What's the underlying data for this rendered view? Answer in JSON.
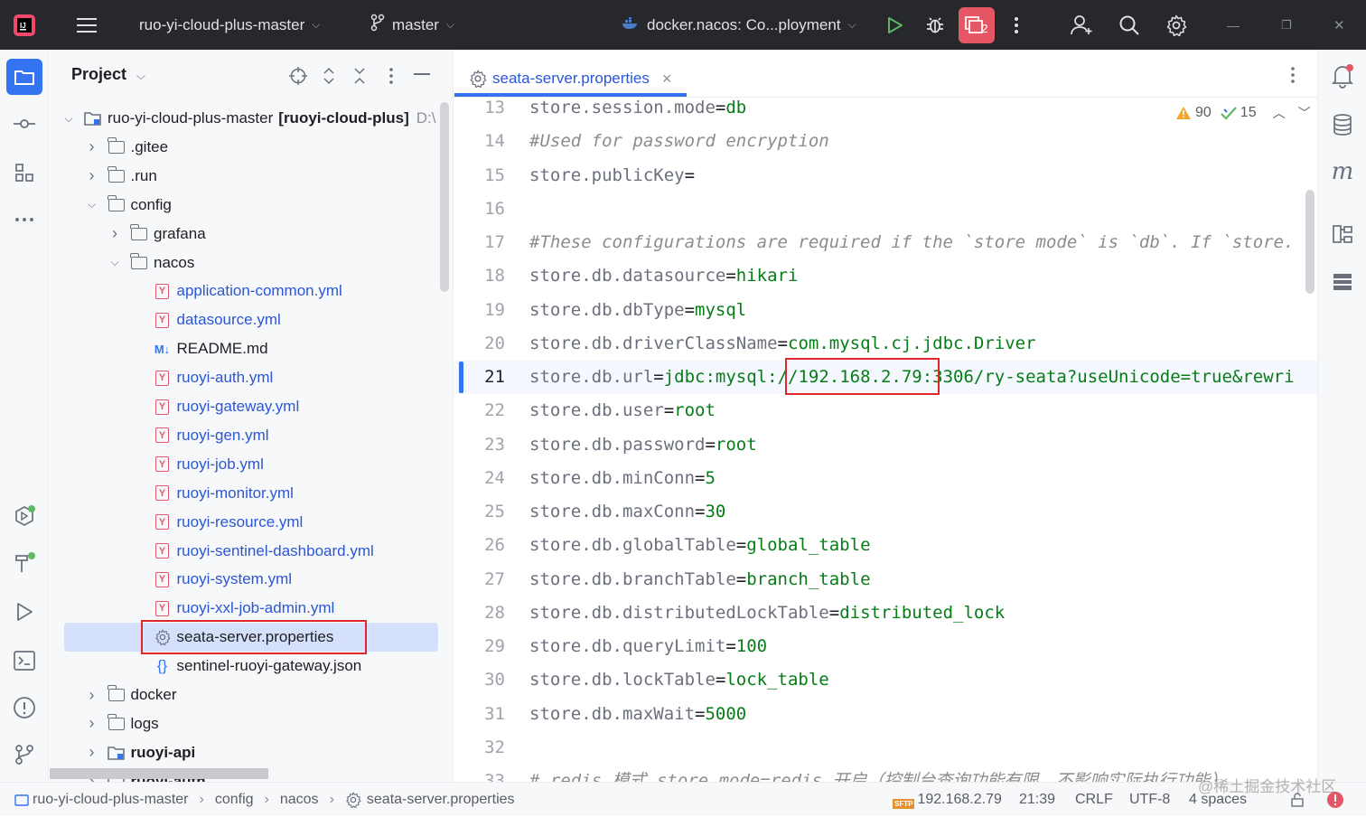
{
  "titlebar": {
    "project_name": "ruo-yi-cloud-plus-master",
    "branch": "master",
    "run_config": "docker.nacos: Co...ployment",
    "vcs_badge": "2",
    "minimize": "—",
    "restore": "❐",
    "close": "✕"
  },
  "project_panel": {
    "title": "Project",
    "tree": [
      {
        "label": "ruo-yi-cloud-plus-master",
        "suffix": "[ruoyi-cloud-plus]",
        "path": "D:\\",
        "type": "module",
        "expanded": true
      },
      {
        "label": ".gitee",
        "type": "folder",
        "expanded": false
      },
      {
        "label": ".run",
        "type": "folder",
        "expanded": false
      },
      {
        "label": "config",
        "type": "folder",
        "expanded": true
      },
      {
        "label": "grafana",
        "type": "folder",
        "expanded": false
      },
      {
        "label": "nacos",
        "type": "folder",
        "expanded": true
      },
      {
        "label": "application-common.yml",
        "type": "yml"
      },
      {
        "label": "datasource.yml",
        "type": "yml"
      },
      {
        "label": "README.md",
        "type": "md"
      },
      {
        "label": "ruoyi-auth.yml",
        "type": "yml"
      },
      {
        "label": "ruoyi-gateway.yml",
        "type": "yml"
      },
      {
        "label": "ruoyi-gen.yml",
        "type": "yml"
      },
      {
        "label": "ruoyi-job.yml",
        "type": "yml"
      },
      {
        "label": "ruoyi-monitor.yml",
        "type": "yml"
      },
      {
        "label": "ruoyi-resource.yml",
        "type": "yml"
      },
      {
        "label": "ruoyi-sentinel-dashboard.yml",
        "type": "yml"
      },
      {
        "label": "ruoyi-system.yml",
        "type": "yml"
      },
      {
        "label": "ruoyi-xxl-job-admin.yml",
        "type": "yml"
      },
      {
        "label": "seata-server.properties",
        "type": "properties",
        "selected": true
      },
      {
        "label": "sentinel-ruoyi-gateway.json",
        "type": "json"
      },
      {
        "label": "docker",
        "type": "folder",
        "expanded": false
      },
      {
        "label": "logs",
        "type": "folder",
        "expanded": false
      },
      {
        "label": "ruoyi-api",
        "type": "module",
        "expanded": false
      },
      {
        "label": "ruoyi-auth",
        "type": "module",
        "expanded": false
      }
    ]
  },
  "editor": {
    "tab_label": "seata-server.properties",
    "tab_close": "×",
    "warnings": "90",
    "checks": "15",
    "lines": [
      {
        "n": "13",
        "key": "store.session.mode",
        "val": "db"
      },
      {
        "n": "14",
        "comment": "#Used for password encryption"
      },
      {
        "n": "15",
        "key": "store.publicKey",
        "val": ""
      },
      {
        "n": "16"
      },
      {
        "n": "17",
        "comment": "#These configurations are required if the `store mode` is `db`. If `store."
      },
      {
        "n": "18",
        "key": "store.db.datasource",
        "val": "hikari"
      },
      {
        "n": "19",
        "key": "store.db.dbType",
        "val": "mysql"
      },
      {
        "n": "20",
        "key": "store.db.driverClassName",
        "val": "com.mysql.cj.jdbc.Driver"
      },
      {
        "n": "21",
        "key": "store.db.url",
        "val": "jdbc:mysql://192.168.2.79:3306/ry-seata?useUnicode=true&rewri",
        "current": true
      },
      {
        "n": "22",
        "key": "store.db.user",
        "val": "root"
      },
      {
        "n": "23",
        "key": "store.db.password",
        "val": "root"
      },
      {
        "n": "24",
        "key": "store.db.minConn",
        "val": "5"
      },
      {
        "n": "25",
        "key": "store.db.maxConn",
        "val": "30"
      },
      {
        "n": "26",
        "key": "store.db.globalTable",
        "val": "global_table"
      },
      {
        "n": "27",
        "key": "store.db.branchTable",
        "val": "branch_table"
      },
      {
        "n": "28",
        "key": "store.db.distributedLockTable",
        "val": "distributed_lock"
      },
      {
        "n": "29",
        "key": "store.db.queryLimit",
        "val": "100"
      },
      {
        "n": "30",
        "key": "store.db.lockTable",
        "val": "lock_table"
      },
      {
        "n": "31",
        "key": "store.db.maxWait",
        "val": "5000"
      },
      {
        "n": "32"
      },
      {
        "n": "33",
        "comment": "# redis 模式 store.mode=redis 开启（控制台查询功能有限，不影响实际执行功能）"
      }
    ]
  },
  "statusbar": {
    "breadcrumb": [
      "ruo-yi-cloud-plus-master",
      "config",
      "nacos",
      "seata-server.properties"
    ],
    "sftp_label": "SFTP",
    "host": "192.168.2.79",
    "position": "21:39",
    "line_sep": "CRLF",
    "encoding": "UTF-8",
    "indent": "4 spaces"
  },
  "watermark": "@稀土掘金技术社区",
  "colors": {
    "accent": "#3574f0",
    "value_green": "#067d17",
    "highlight_red": "#e0262b",
    "titlebar_bg": "#27282c"
  }
}
